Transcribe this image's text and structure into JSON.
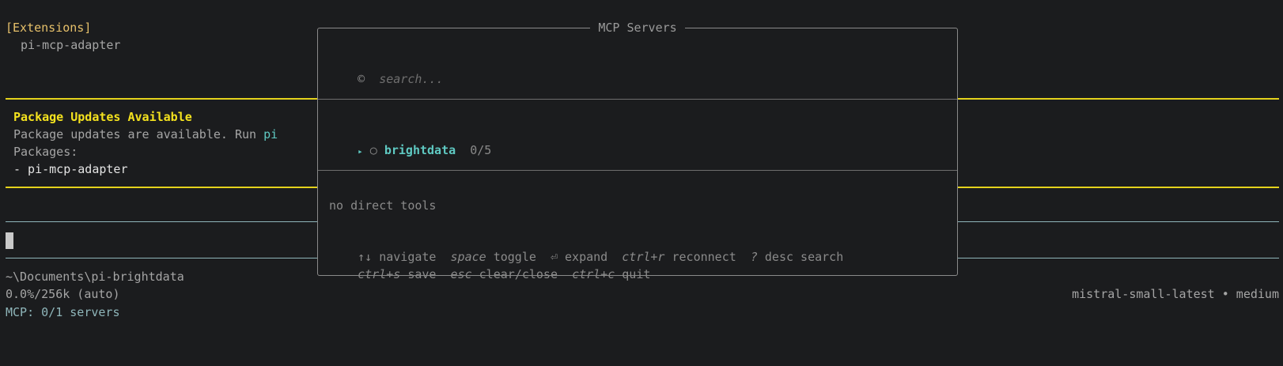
{
  "extensions": {
    "header": "[Extensions]",
    "items": [
      "pi-mcp-adapter"
    ]
  },
  "updates": {
    "title": "Package Updates Available",
    "message_prefix": "Package updates are available. Run ",
    "message_cmd": "pi",
    "packages_label": "Packages:",
    "packages": [
      "- pi-mcp-adapter"
    ]
  },
  "status": {
    "cwd": "~\\Documents\\pi-brightdata",
    "usage": "0.0%/256k (auto)",
    "mcp": "MCP: 0/1 servers",
    "model": "mistral-small-latest • medium"
  },
  "modal": {
    "title": "MCP Servers",
    "search_icon": "©",
    "search_placeholder": "search...",
    "servers": [
      {
        "arrow": "▸",
        "state_icon": "○",
        "name": "brightdata",
        "count": "0/5"
      }
    ],
    "tools_text": "no direct tools",
    "hints_row1": [
      {
        "key": "↑↓",
        "key_italic": false,
        "label": "navigate"
      },
      {
        "key": "space",
        "key_italic": true,
        "label": "toggle"
      },
      {
        "key": "⏎",
        "key_italic": false,
        "label": "expand"
      },
      {
        "key": "ctrl+r",
        "key_italic": true,
        "label": "reconnect"
      },
      {
        "key": "?",
        "key_italic": true,
        "label": "desc search"
      }
    ],
    "hints_row2": [
      {
        "key": "ctrl+s",
        "key_italic": true,
        "label": "save"
      },
      {
        "key": "esc",
        "key_italic": true,
        "label": "clear/close"
      },
      {
        "key": "ctrl+c",
        "key_italic": true,
        "label": "quit"
      }
    ]
  },
  "colors": {
    "background": "#1b1c1e",
    "accent_yellow": "#f4e21e",
    "accent_teal": "#8fb6ba",
    "accent_cyan": "#5fc9c2"
  }
}
